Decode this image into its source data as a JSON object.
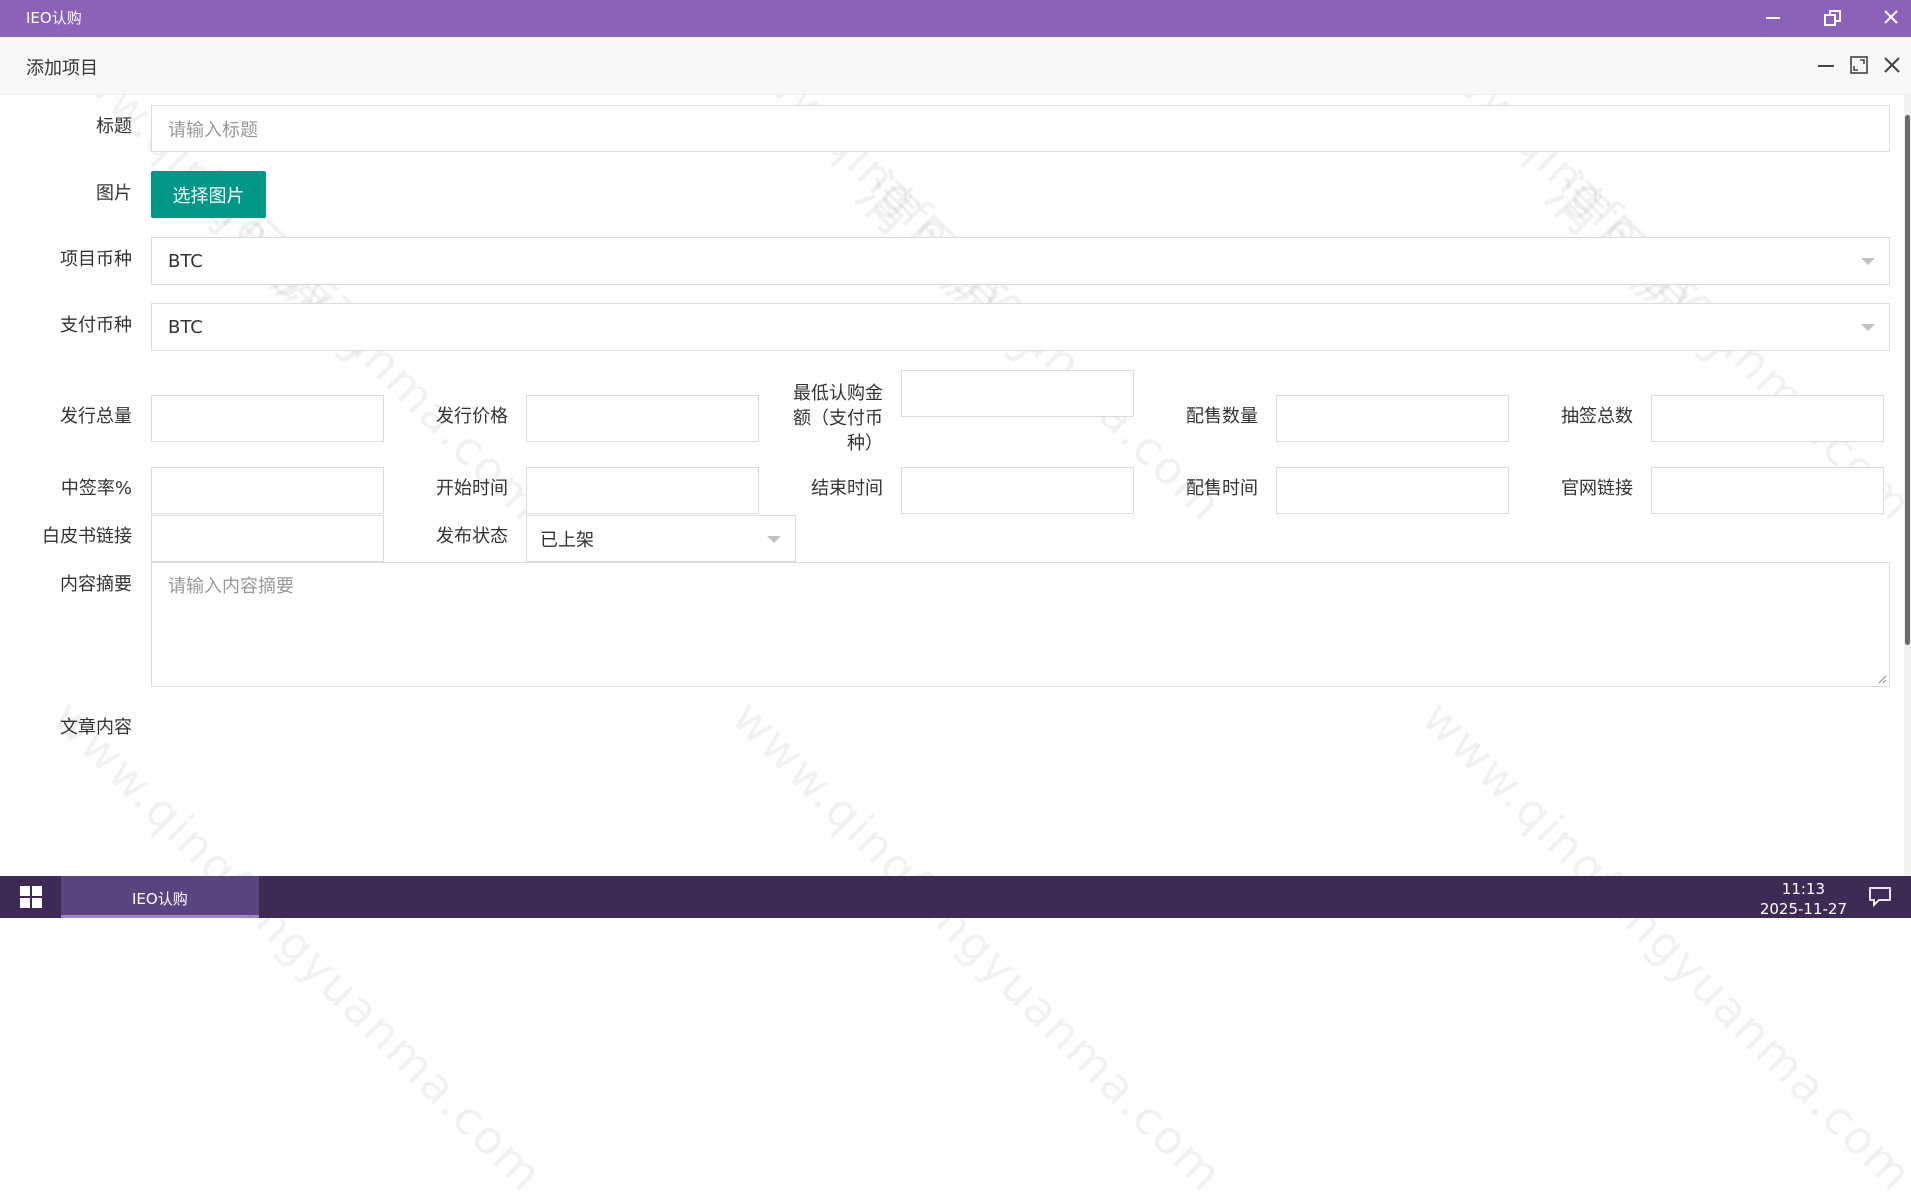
{
  "app": {
    "title": "IEO认购",
    "titlebar_color": "#8a63b8"
  },
  "modal": {
    "title": "添加项目"
  },
  "form": {
    "title_label": "标题",
    "title_placeholder": "请输入标题",
    "image_label": "图片",
    "choose_image_button": "选择图片",
    "project_currency_label": "项目币种",
    "project_currency_value": "BTC",
    "pay_currency_label": "支付币种",
    "pay_currency_value": "BTC",
    "issue_total_label": "发行总量",
    "issue_price_label": "发行价格",
    "min_purchase_label_line1": "最低认购金",
    "min_purchase_label_line2": "额（支付币",
    "min_purchase_label_line3": "种）",
    "allotment_qty_label": "配售数量",
    "lottery_total_label": "抽签总数",
    "win_rate_label": "中签率%",
    "start_time_label": "开始时间",
    "end_time_label": "结束时间",
    "allotment_time_label": "配售时间",
    "website_link_label": "官网链接",
    "whitepaper_link_label": "白皮书链接",
    "publish_status_label": "发布状态",
    "publish_status_value": "已上架",
    "summary_label": "内容摘要",
    "summary_placeholder": "请输入内容摘要",
    "article_content_label": "文章内容"
  },
  "taskbar": {
    "task_label": "IEO认购",
    "time": "11:13",
    "date": "2025-11-27"
  },
  "watermark": {
    "url_text": "www.qingfengyuanma.com",
    "cn_text": "清风源码"
  },
  "colors": {
    "accent_button": "#009688",
    "taskbar": "#3d2a55"
  }
}
